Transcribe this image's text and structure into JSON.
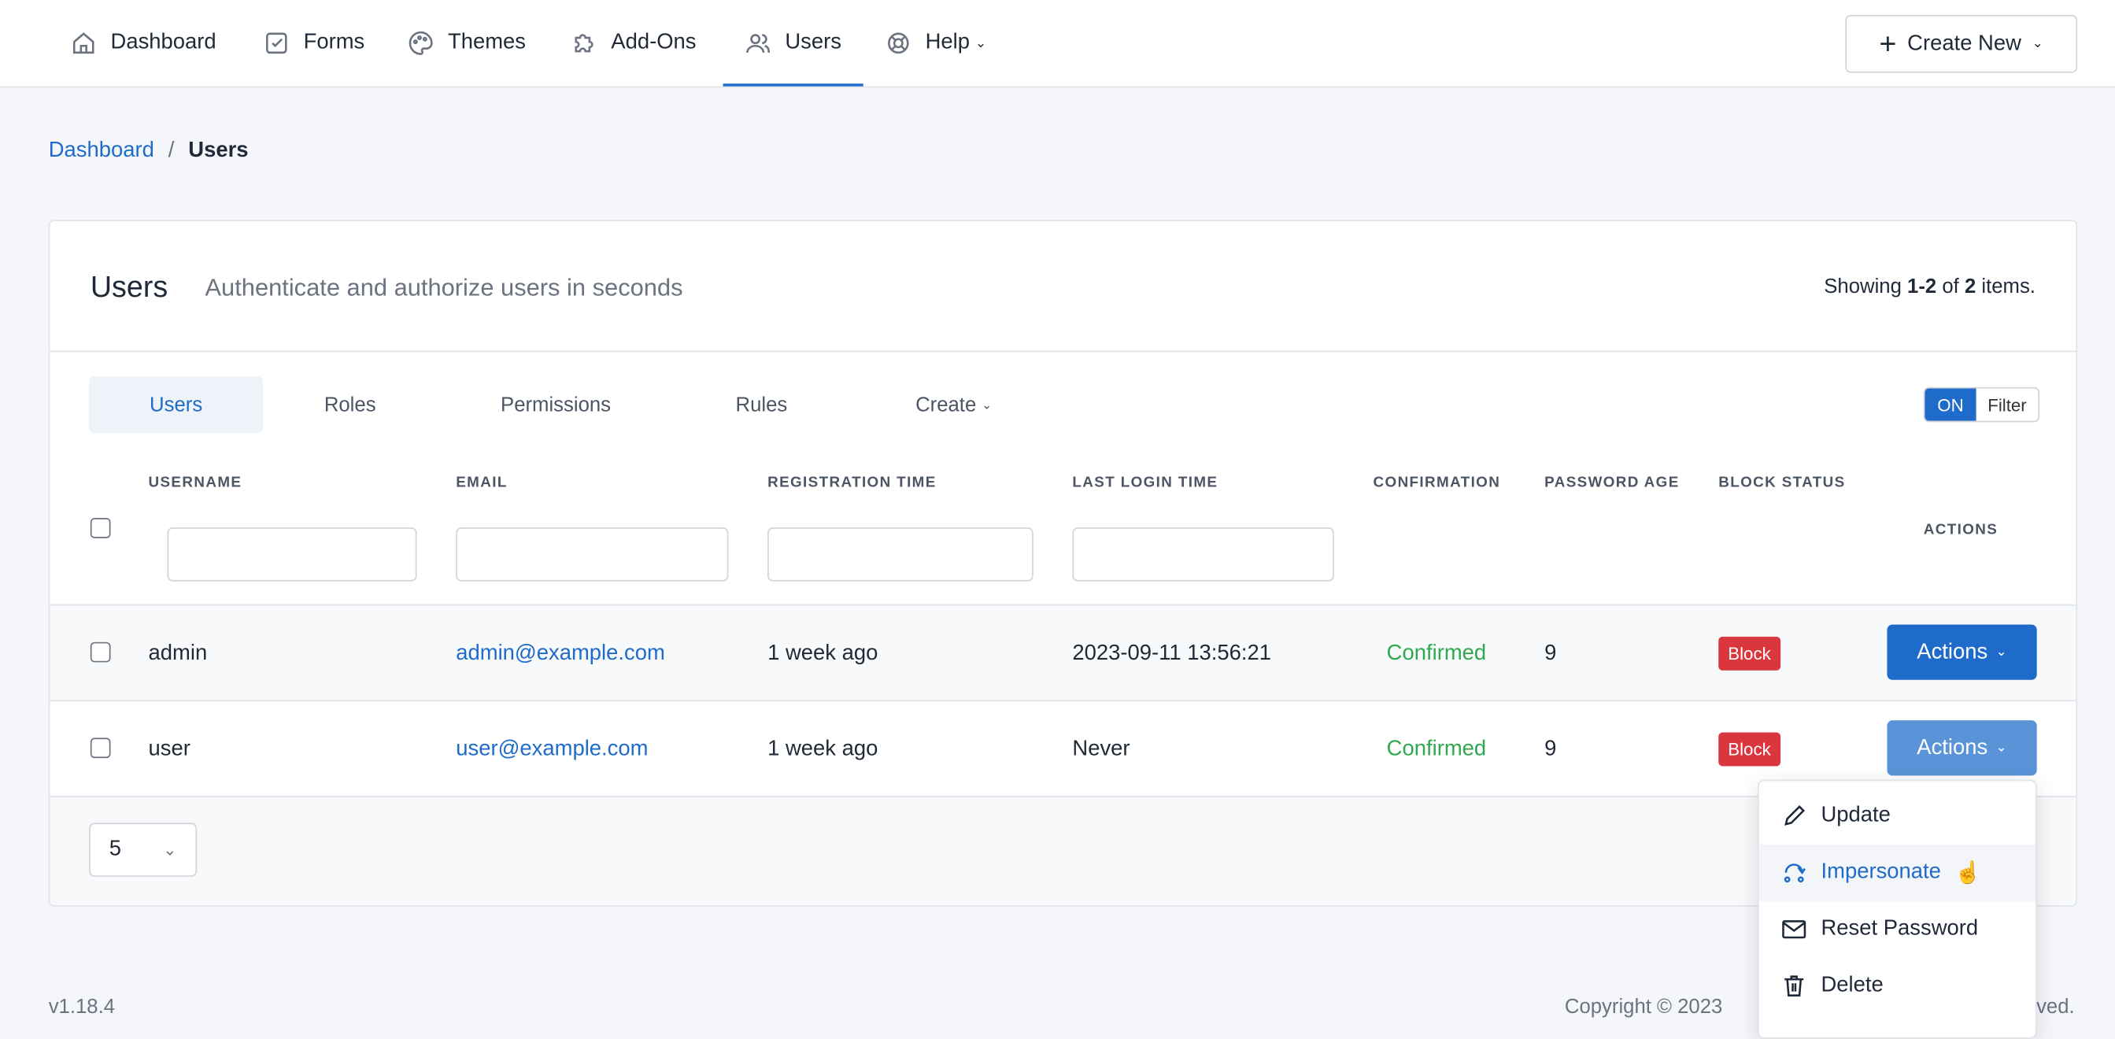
{
  "nav": {
    "items": [
      {
        "label": "Dashboard",
        "icon": "home-icon"
      },
      {
        "label": "Forms",
        "icon": "checkbox-icon"
      },
      {
        "label": "Themes",
        "icon": "palette-icon"
      },
      {
        "label": "Add-Ons",
        "icon": "puzzle-icon"
      },
      {
        "label": "Users",
        "icon": "users-icon",
        "active": true
      },
      {
        "label": "Help",
        "icon": "lifebuoy-icon"
      }
    ],
    "create_new": "Create New"
  },
  "breadcrumb": {
    "parent": "Dashboard",
    "separator": "/",
    "current": "Users"
  },
  "card": {
    "title": "Users",
    "subtitle": "Authenticate and authorize users in seconds",
    "showing_prefix": "Showing ",
    "showing_range": "1-2",
    "showing_of": " of ",
    "showing_total": "2",
    "showing_suffix": " items."
  },
  "tabs": [
    "Users",
    "Roles",
    "Permissions",
    "Rules",
    "Create"
  ],
  "filter_toggle": {
    "on": "ON",
    "label": "Filter"
  },
  "columns": [
    "USERNAME",
    "EMAIL",
    "REGISTRATION TIME",
    "LAST LOGIN TIME",
    "CONFIRMATION",
    "PASSWORD AGE",
    "BLOCK STATUS",
    "ACTIONS"
  ],
  "rows": [
    {
      "username": "admin",
      "email": "admin@example.com",
      "registered": "1 week ago",
      "last_login": "2023-09-11 13:56:21",
      "confirmation": "Confirmed",
      "password_age": "9",
      "block": "Block",
      "actions": "Actions"
    },
    {
      "username": "user",
      "email": "user@example.com",
      "registered": "1 week ago",
      "last_login": "Never",
      "confirmation": "Confirmed",
      "password_age": "9",
      "block": "Block",
      "actions": "Actions"
    }
  ],
  "page_size": "5",
  "actions_menu": [
    "Update",
    "Impersonate",
    "Reset Password",
    "Delete"
  ],
  "footer": {
    "version": "v1.18.4",
    "copyright_left": "Copyright © 2023",
    "copyright_right": "ved."
  },
  "colors": {
    "accent": "#1f6bc9",
    "danger": "#d9363e",
    "success": "#2fa84f"
  }
}
